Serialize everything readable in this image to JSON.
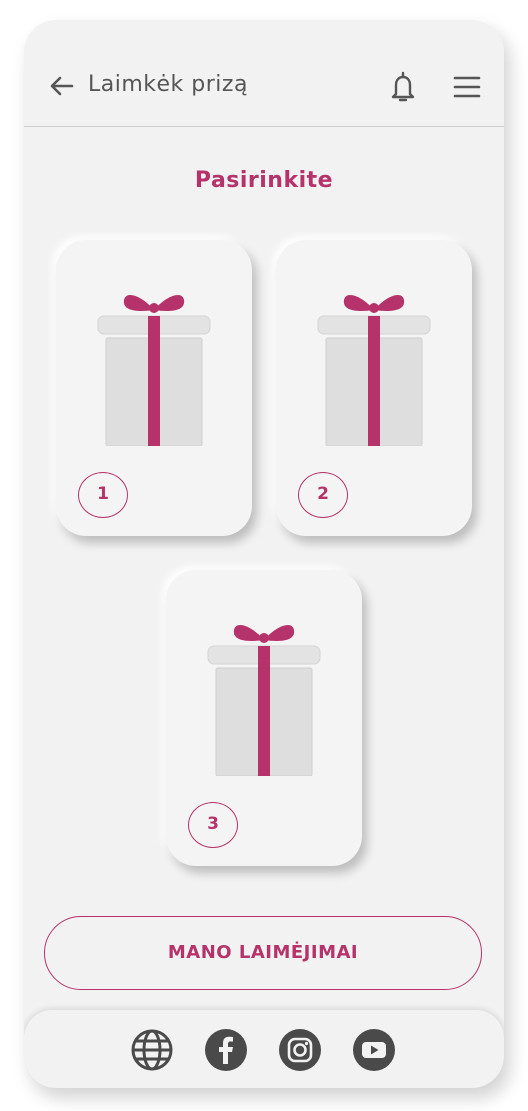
{
  "header": {
    "title": "Laimkėk prizą",
    "back_icon": "arrow-left-icon",
    "notification_icon": "bell-icon",
    "menu_icon": "hamburger-menu-icon"
  },
  "main": {
    "subtitle": "Pasirinkite",
    "gifts": [
      {
        "number": "1",
        "icon": "gift-icon"
      },
      {
        "number": "2",
        "icon": "gift-icon"
      },
      {
        "number": "3",
        "icon": "gift-icon"
      }
    ],
    "cta_label": "MANO LAIMĖJIMAI"
  },
  "footer": {
    "social": [
      "globe-icon",
      "facebook-icon",
      "instagram-icon",
      "youtube-icon"
    ]
  },
  "colors": {
    "accent": "#b5336a",
    "background": "#f2f2f2",
    "text": "#555555",
    "icon_dark": "#4a4a4a"
  }
}
